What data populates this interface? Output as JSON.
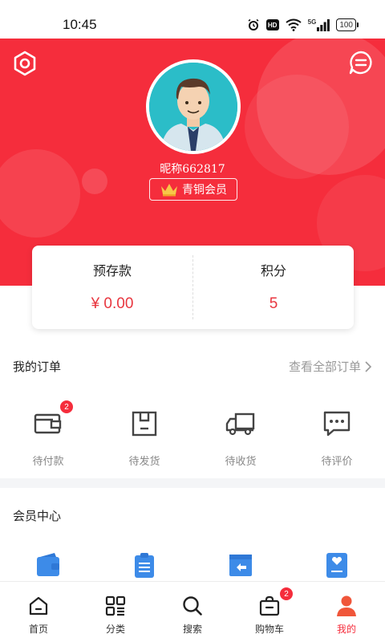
{
  "status_bar": {
    "time": "10:45",
    "hd_label": "HD",
    "network_label": "5G",
    "battery": "100"
  },
  "profile": {
    "nickname": "昵称662817",
    "member_level": "青铜会员"
  },
  "balance_card": {
    "deposit_label": "预存款",
    "deposit_value": "¥ 0.00",
    "points_label": "积分",
    "points_value": "5"
  },
  "orders": {
    "title": "我的订单",
    "view_all": "查看全部订单",
    "items": [
      {
        "label": "待付款",
        "icon": "wallet-icon",
        "badge": "2"
      },
      {
        "label": "待发货",
        "icon": "package-icon"
      },
      {
        "label": "待收货",
        "icon": "truck-icon"
      },
      {
        "label": "待评价",
        "icon": "comment-icon"
      }
    ]
  },
  "member_center": {
    "title": "会员中心",
    "items": [
      {
        "icon": "wallet-blue-icon"
      },
      {
        "icon": "clipboard-icon"
      },
      {
        "icon": "return-icon"
      },
      {
        "icon": "favorite-card-icon"
      }
    ]
  },
  "tab_bar": {
    "items": [
      {
        "label": "首页",
        "icon": "home-icon"
      },
      {
        "label": "分类",
        "icon": "category-icon"
      },
      {
        "label": "搜索",
        "icon": "search-icon"
      },
      {
        "label": "购物车",
        "icon": "cart-icon",
        "badge": "2"
      },
      {
        "label": "我的",
        "icon": "profile-icon",
        "active": true
      }
    ]
  },
  "colors": {
    "primary_red": "#f52d3c",
    "accent_blue": "#3d8be8",
    "muted_text": "#888888"
  }
}
